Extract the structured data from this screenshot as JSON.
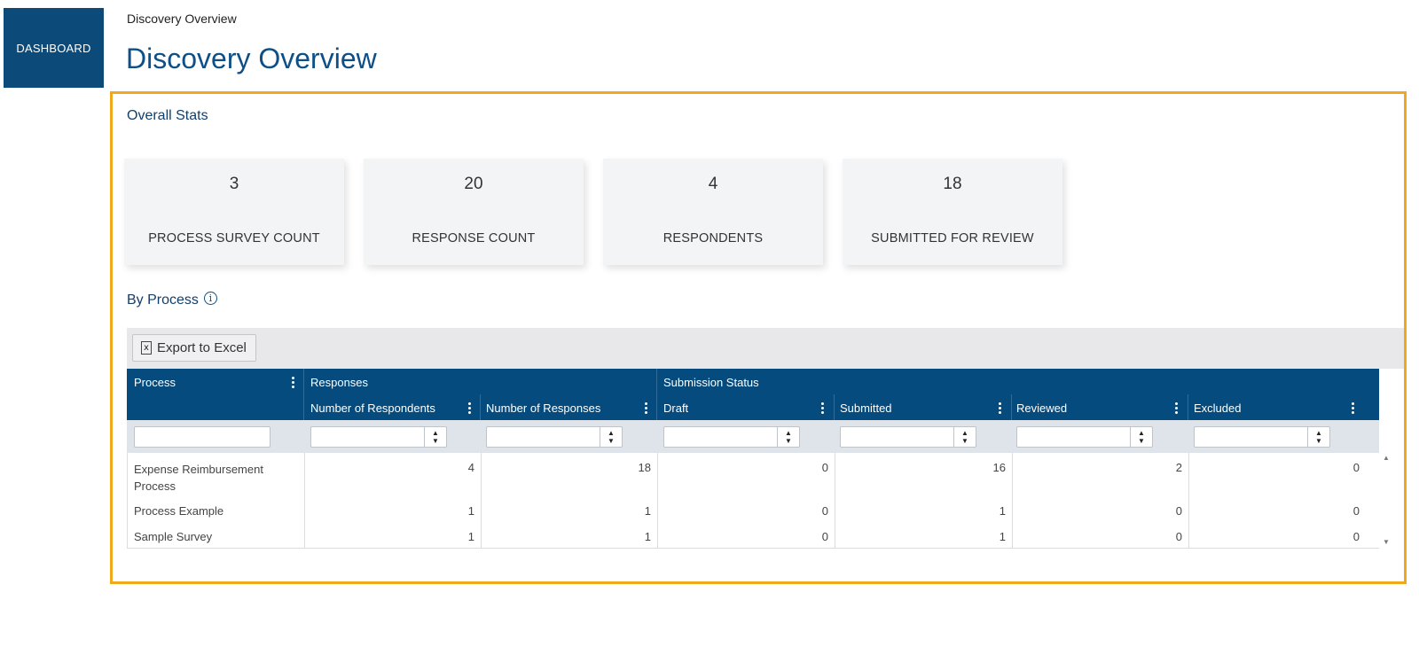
{
  "nav": {
    "dashboard_label": "DASHBOARD"
  },
  "breadcrumb": "Discovery Overview",
  "page_title": "Discovery Overview",
  "overall_stats": {
    "title": "Overall Stats",
    "cards": [
      {
        "value": "3",
        "label": "PROCESS SURVEY COUNT"
      },
      {
        "value": "20",
        "label": "RESPONSE COUNT"
      },
      {
        "value": "4",
        "label": "RESPONDENTS"
      },
      {
        "value": "18",
        "label": "SUBMITTED FOR REVIEW"
      }
    ]
  },
  "by_process": {
    "title": "By Process",
    "info_icon": "info-icon",
    "export_label": "Export to Excel",
    "groups": {
      "responses": "Responses",
      "submission_status": "Submission Status"
    },
    "columns": {
      "process": "Process",
      "respondents": "Number of Respondents",
      "responses": "Number of Responses",
      "draft": "Draft",
      "submitted": "Submitted",
      "reviewed": "Reviewed",
      "excluded": "Excluded"
    },
    "rows": [
      {
        "process": "Expense Reimbursement Process",
        "respondents": "4",
        "responses": "18",
        "draft": "0",
        "submitted": "16",
        "reviewed": "2",
        "excluded": "0"
      },
      {
        "process": "Process Example",
        "respondents": "1",
        "responses": "1",
        "draft": "0",
        "submitted": "1",
        "reviewed": "0",
        "excluded": "0"
      },
      {
        "process": "Sample Survey",
        "respondents": "1",
        "responses": "1",
        "draft": "0",
        "submitted": "1",
        "reviewed": "0",
        "excluded": "0"
      }
    ]
  },
  "colors": {
    "brand": "#064b7d",
    "highlight_border": "#f0a81c",
    "title": "#0d4f86"
  }
}
